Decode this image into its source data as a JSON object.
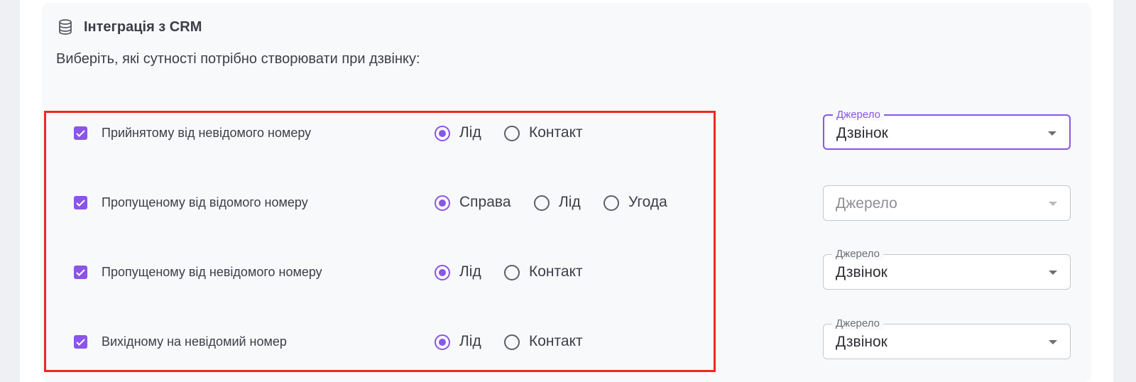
{
  "section": {
    "title": "Інтеграція з CRM",
    "subtitle": "Виберіть, які сутності потрібно створювати при дзвінку:",
    "icon": "database-icon"
  },
  "rows": [
    {
      "label": "Прийнятому від невідомого номеру",
      "checked": true,
      "options": [
        {
          "label": "Лід",
          "checked": true
        },
        {
          "label": "Контакт",
          "checked": false
        }
      ],
      "source": {
        "label": "Джерело",
        "value": "Дзвінок",
        "focused": true
      }
    },
    {
      "label": "Пропущеному від відомого номеру",
      "checked": true,
      "options": [
        {
          "label": "Справа",
          "checked": true
        },
        {
          "label": "Лід",
          "checked": false
        },
        {
          "label": "Угода",
          "checked": false
        }
      ],
      "source": {
        "placeholder": "Джерело",
        "disabled": true
      }
    },
    {
      "label": "Пропущеному від невідомого номеру",
      "checked": true,
      "options": [
        {
          "label": "Лід",
          "checked": true
        },
        {
          "label": "Контакт",
          "checked": false
        }
      ],
      "source": {
        "label": "Джерело",
        "value": "Дзвінок"
      }
    },
    {
      "label": "Вихідному на невідомий номер",
      "checked": true,
      "options": [
        {
          "label": "Лід",
          "checked": true
        },
        {
          "label": "Контакт",
          "checked": false
        }
      ],
      "source": {
        "label": "Джерело",
        "value": "Дзвінок"
      }
    }
  ],
  "colors": {
    "accent": "#8a55e8",
    "highlight": "#f0291d"
  }
}
